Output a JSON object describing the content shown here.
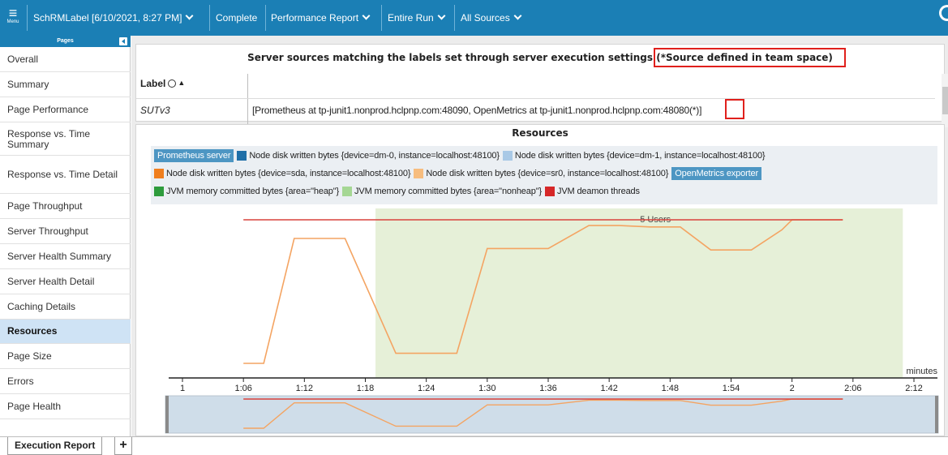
{
  "toolbar": {
    "menu_label": "Menu",
    "report_name": "SchRMLabel [6/10/2021, 8:27 PM]",
    "status": "Complete",
    "report_type": "Performance Report",
    "run_scope": "Entire Run",
    "sources": "All Sources"
  },
  "sidebar": {
    "header": "Pages",
    "items": [
      {
        "label": "Overall"
      },
      {
        "label": "Summary"
      },
      {
        "label": "Page Performance"
      },
      {
        "label": "Response vs. Time Summary"
      },
      {
        "label": "Response vs. Time Detail"
      },
      {
        "label": "Page Throughput"
      },
      {
        "label": "Server Throughput"
      },
      {
        "label": "Server Health Summary"
      },
      {
        "label": "Server Health Detail"
      },
      {
        "label": "Caching Details"
      },
      {
        "label": "Resources"
      },
      {
        "label": "Page Size"
      },
      {
        "label": "Errors"
      },
      {
        "label": "Page Health"
      }
    ],
    "active_index": 10
  },
  "sources_panel": {
    "title": "Server sources matching the labels set through server execution settings",
    "title_note": "(*Source defined in team space)",
    "column_label": "Label",
    "rows": [
      {
        "label": "SUTv3",
        "value": "[Prometheus at tp-junit1.nonprod.hclpnp.com:48090, OpenMetrics at tp-junit1.nonprod.hclpnp.com:48080",
        "marker": "(*)",
        "close": "]"
      }
    ]
  },
  "resources": {
    "title": "Resources",
    "legend": {
      "row1_head": "Prometheus server",
      "row1": [
        {
          "text": "Node disk written bytes {device=dm-0, instance=localhost:48100}",
          "color": "#1f6fa8"
        },
        {
          "text": "Node disk written bytes {device=dm-1, instance=localhost:48100}",
          "color": "#a9c9e6"
        }
      ],
      "row2": [
        {
          "text": "Node disk written bytes {device=sda, instance=localhost:48100}",
          "color": "#f07f1e"
        },
        {
          "text": "Node disk written bytes {device=sr0, instance=localhost:48100}",
          "color": "#f7bd7e"
        }
      ],
      "row2_head": "OpenMetrics exporter",
      "row3": [
        {
          "text": "JVM memory committed bytes {area=\"heap\"}",
          "color": "#2e9c3d"
        },
        {
          "text": "JVM memory committed bytes {area=\"nonheap\"}",
          "color": "#a5d794"
        },
        {
          "text": "JVM deamon threads",
          "color": "#d62728"
        }
      ]
    }
  },
  "chart_data": {
    "type": "line",
    "xlabel": "minutes",
    "x_ticks": [
      "1",
      "1:06",
      "1:12",
      "1:18",
      "1:24",
      "1:30",
      "1:36",
      "1:42",
      "1:48",
      "1:54",
      "2",
      "2:06",
      "2:12"
    ],
    "x_range": [
      1,
      2.2
    ],
    "annotation": "5 Users",
    "shaded_range": [
      1.3167,
      2.0833
    ],
    "shaded_color": "#e6f0d8",
    "series": [
      {
        "color": "#f4a462",
        "points": [
          [
            1.1,
            0.0
          ],
          [
            1.1333,
            0.0
          ],
          [
            1.1833,
            0.87
          ],
          [
            1.2667,
            0.87
          ],
          [
            1.35,
            0.07
          ],
          [
            1.45,
            0.07
          ],
          [
            1.5,
            0.8
          ],
          [
            1.6,
            0.8
          ],
          [
            1.6667,
            0.96
          ],
          [
            1.7167,
            0.96
          ],
          [
            1.7667,
            0.95
          ],
          [
            1.8167,
            0.95
          ],
          [
            1.8667,
            0.79
          ],
          [
            1.9333,
            0.79
          ],
          [
            1.9833,
            0.93
          ],
          [
            2.0,
            1.0
          ],
          [
            2.0833,
            1.0
          ]
        ]
      },
      {
        "color": "#d9423c",
        "points": [
          [
            1.1,
            1.0
          ],
          [
            2.0833,
            1.0
          ]
        ]
      }
    ]
  },
  "tabs": {
    "execution_report": "Execution Report",
    "add": "+"
  }
}
